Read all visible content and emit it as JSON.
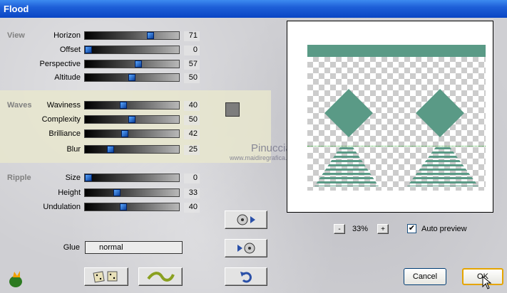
{
  "window": {
    "title": "Flood"
  },
  "sections": {
    "view": "View",
    "waves": "Waves",
    "ripple": "Ripple"
  },
  "sliders": [
    {
      "label": "Horizon",
      "value": "71",
      "fraction": 0.71
    },
    {
      "label": "Offset",
      "value": "0",
      "fraction": 0.0
    },
    {
      "label": "Perspective",
      "value": "57",
      "fraction": 0.57
    },
    {
      "label": "Altitude",
      "value": "50",
      "fraction": 0.5
    },
    {
      "label": "Waviness",
      "value": "40",
      "fraction": 0.4
    },
    {
      "label": "Complexity",
      "value": "50",
      "fraction": 0.5
    },
    {
      "label": "Brilliance",
      "value": "42",
      "fraction": 0.42
    },
    {
      "label": "Blur",
      "value": "25",
      "fraction": 0.25
    },
    {
      "label": "Size",
      "value": "0",
      "fraction": 0.0
    },
    {
      "label": "Height",
      "value": "33",
      "fraction": 0.33
    },
    {
      "label": "Undulation",
      "value": "40",
      "fraction": 0.4
    }
  ],
  "glue": {
    "label": "Glue",
    "value": "normal"
  },
  "zoom": {
    "value": "33%",
    "minus": "-",
    "plus": "+"
  },
  "auto_preview": {
    "label": "Auto preview",
    "checked": true
  },
  "buttons": {
    "cancel": "Cancel",
    "ok": "OK"
  },
  "watermark": {
    "line1": "Pinuccia",
    "line2": "www.maidiregrafica.eu"
  },
  "colors": {
    "wave_color": "#7d7d7d",
    "preview_green": "#5a9a86"
  },
  "icons": {
    "app": "filter-factory-icon",
    "randomize": "dice-icon",
    "reset": "wave-icon",
    "load": "disc-arrow-right-icon",
    "save": "arrow-disc-icon",
    "undo": "undo-icon"
  }
}
